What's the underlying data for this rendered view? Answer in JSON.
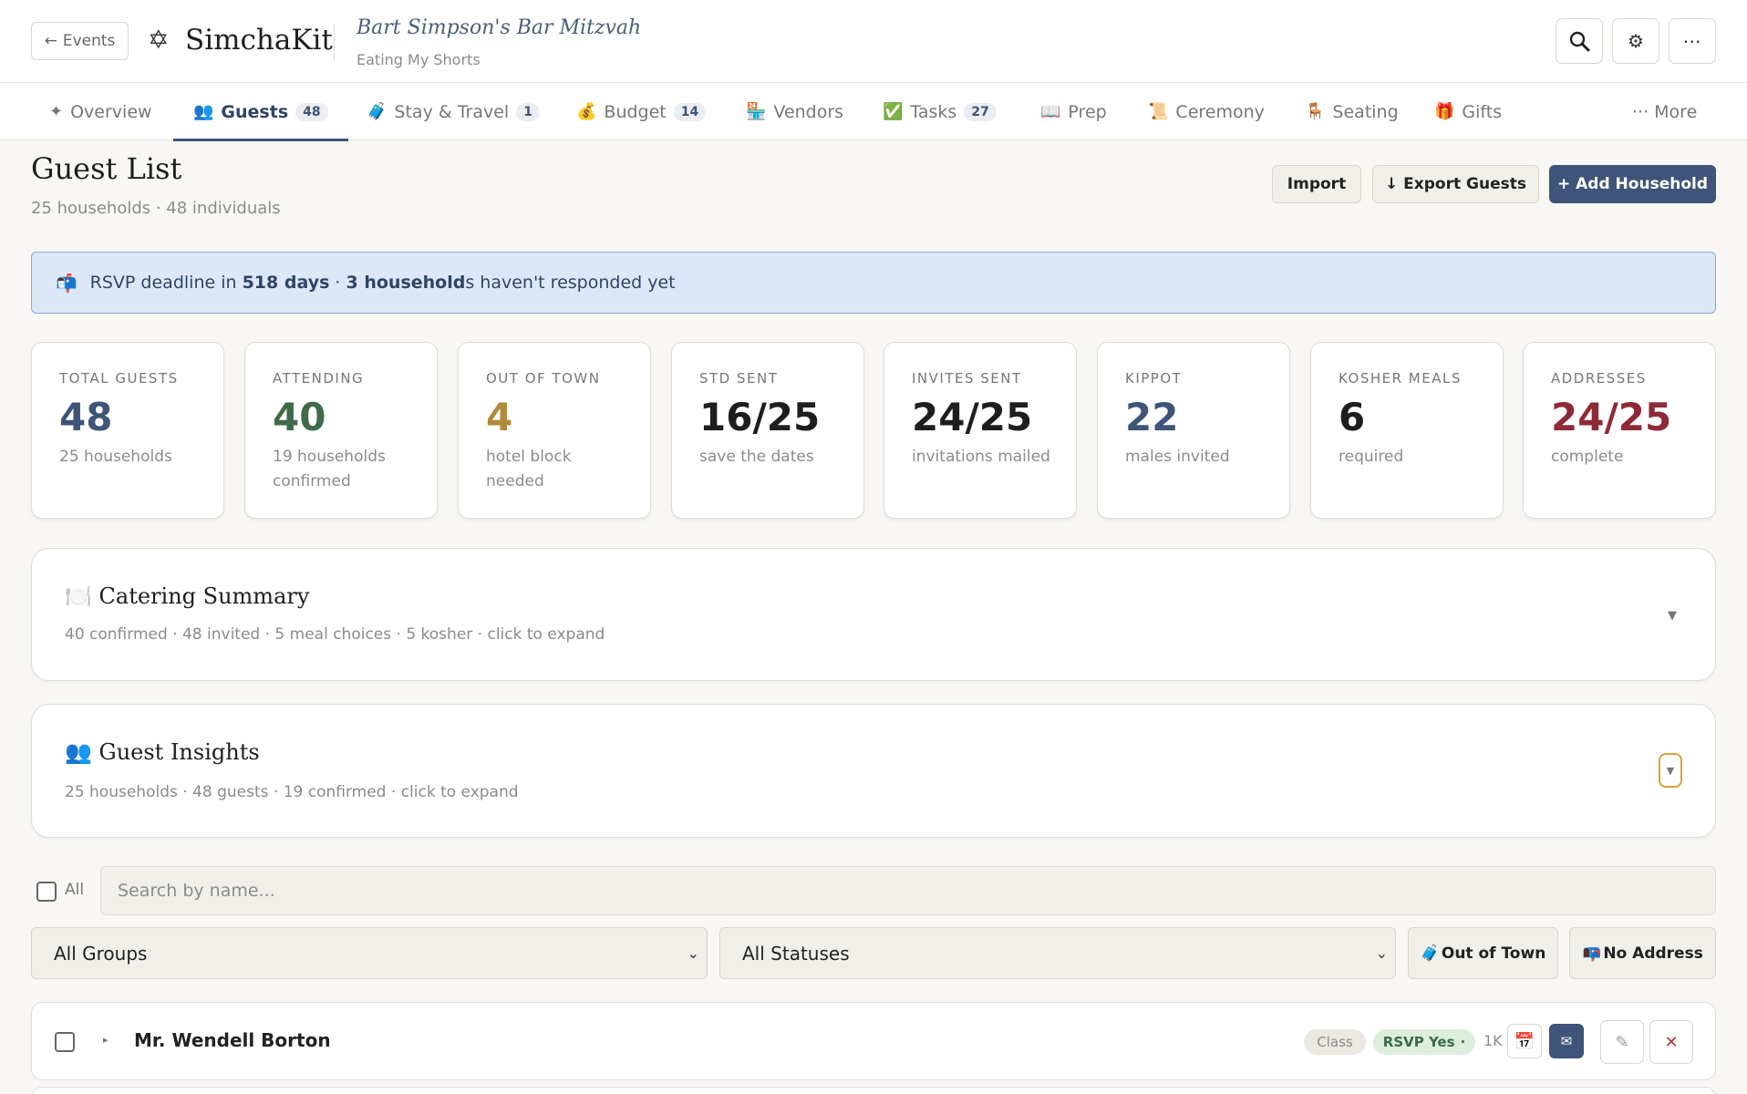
{
  "header": {
    "back_label": "Events",
    "brand": "SimchaKit",
    "event_title": "Bart Simpson's Bar Mitzvah",
    "event_subtitle": "Eating My Shorts"
  },
  "tabs": [
    {
      "icon": "✦",
      "label": "Overview",
      "badge": ""
    },
    {
      "icon": "👥",
      "label": "Guests",
      "badge": "48"
    },
    {
      "icon": "🧳",
      "label": "Stay & Travel",
      "badge": "1"
    },
    {
      "icon": "💰",
      "label": "Budget",
      "badge": "14"
    },
    {
      "icon": "🏪",
      "label": "Vendors",
      "badge": ""
    },
    {
      "icon": "✅",
      "label": "Tasks",
      "badge": "27"
    },
    {
      "icon": "📖",
      "label": "Prep",
      "badge": ""
    },
    {
      "icon": "📜",
      "label": "Ceremony",
      "badge": ""
    },
    {
      "icon": "🪑",
      "label": "Seating",
      "badge": ""
    },
    {
      "icon": "🎁",
      "label": "Gifts",
      "badge": ""
    }
  ],
  "more_label": "··· More",
  "page": {
    "title": "Guest List",
    "subtitle": "25 households · 48 individuals",
    "import_label": "Import",
    "export_label": "↓ Export Guests",
    "add_label": "+ Add Household"
  },
  "banner": {
    "icon": "📬",
    "prefix": "RSVP deadline in ",
    "days": "518 days",
    "mid": " · ",
    "households": "3 household",
    "suffix": "s haven't responded yet"
  },
  "stats": [
    {
      "label": "TOTAL GUESTS",
      "value": "48",
      "desc": "25 households",
      "color": "#3e5478"
    },
    {
      "label": "ATTENDING",
      "value": "40",
      "desc": "19 households confirmed",
      "color": "#3f6b48"
    },
    {
      "label": "OUT OF TOWN",
      "value": "4",
      "desc": "hotel block needed",
      "color": "#b08a3a"
    },
    {
      "label": "STD SENT",
      "value": "16/25",
      "desc": "save the dates",
      "color": "#1e1e1e"
    },
    {
      "label": "INVITES SENT",
      "value": "24/25",
      "desc": "invitations mailed",
      "color": "#1e1e1e"
    },
    {
      "label": "KIPPOT",
      "value": "22",
      "desc": "males invited",
      "color": "#3e5478"
    },
    {
      "label": "KOSHER MEALS",
      "value": "6",
      "desc": "required",
      "color": "#1e1e1e"
    },
    {
      "label": "ADDRESSES",
      "value": "24/25",
      "desc": "complete",
      "color": "#8e2a36"
    }
  ],
  "catering": {
    "icon": "🍽️",
    "title": "Catering Summary",
    "subtitle": "40 confirmed · 48 invited · 5 meal choices · 5 kosher · click to expand"
  },
  "insights": {
    "icon": "👥",
    "title": "Guest Insights",
    "subtitle": "25 households · 48 guests · 19 confirmed · click to expand"
  },
  "filters": {
    "all_label": "All",
    "search_placeholder": "Search by name...",
    "group_select": "All Groups",
    "status_select": "All Statuses",
    "out_of_town": "Out of Town",
    "out_of_town_icon": "🧳",
    "no_address": "No Address",
    "no_address_icon": "📭"
  },
  "households": [
    {
      "name": "Mr. Wendell Borton",
      "group": "Class",
      "rsvp": "RSVP Yes",
      "rsvp_dot": "·",
      "count": "1K",
      "calendar_icon": "📅",
      "mail_icon": "✉",
      "edit_icon": "✎",
      "delete_icon": "✕"
    }
  ]
}
